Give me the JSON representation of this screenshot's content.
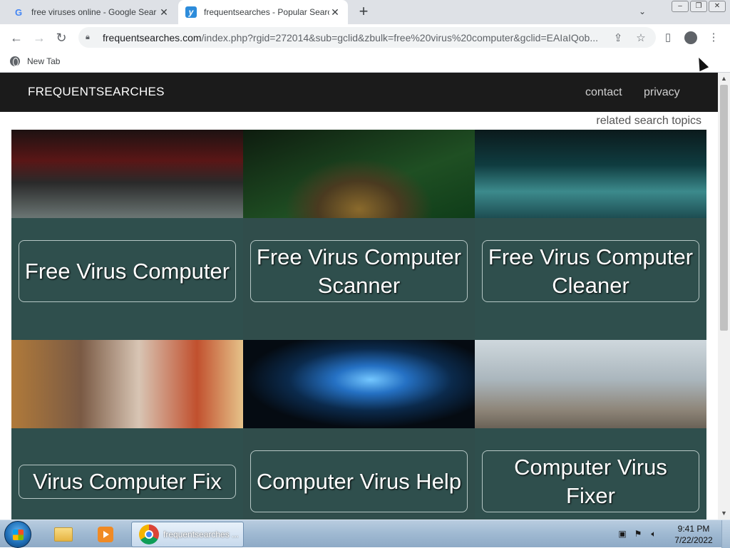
{
  "browser": {
    "tabs": [
      {
        "title": "free viruses online - Google Sear",
        "favicon": "google-icon",
        "active": false
      },
      {
        "title": "frequentsearches - Popular Searc",
        "favicon": "site-y-icon",
        "active": true
      }
    ],
    "new_tab_symbol": "+",
    "address": {
      "host": "frequentsearches.com",
      "path": "/index.php?rgid=272014&sub=gclid&zbulk=free%20virus%20computer&gclid=EAIaIQob..."
    },
    "bookmarks": [
      {
        "label": "New Tab"
      }
    ]
  },
  "site": {
    "logo": "FREQUENTSEARCHES",
    "nav": {
      "contact": "contact",
      "privacy": "privacy"
    },
    "related_label": "related search topics",
    "cards": [
      {
        "label": "Free Virus Computer",
        "image": "keyboard-chains-image"
      },
      {
        "label": "Free Virus Computer Scanner",
        "image": "padlock-circuit-image"
      },
      {
        "label": "Free Virus Computer Cleaner",
        "image": "circuit-board-image"
      },
      {
        "label": "Virus Computer Fix",
        "image": "store-shelf-image"
      },
      {
        "label": "Computer Virus Help",
        "image": "blue-light-streak-image"
      },
      {
        "label": "Computer Virus Fixer",
        "image": "laptop-phone-image"
      }
    ]
  },
  "taskbar": {
    "active_task": "frequentsearches ...",
    "clock_time": "9:41 PM",
    "clock_date": "7/22/2022"
  }
}
